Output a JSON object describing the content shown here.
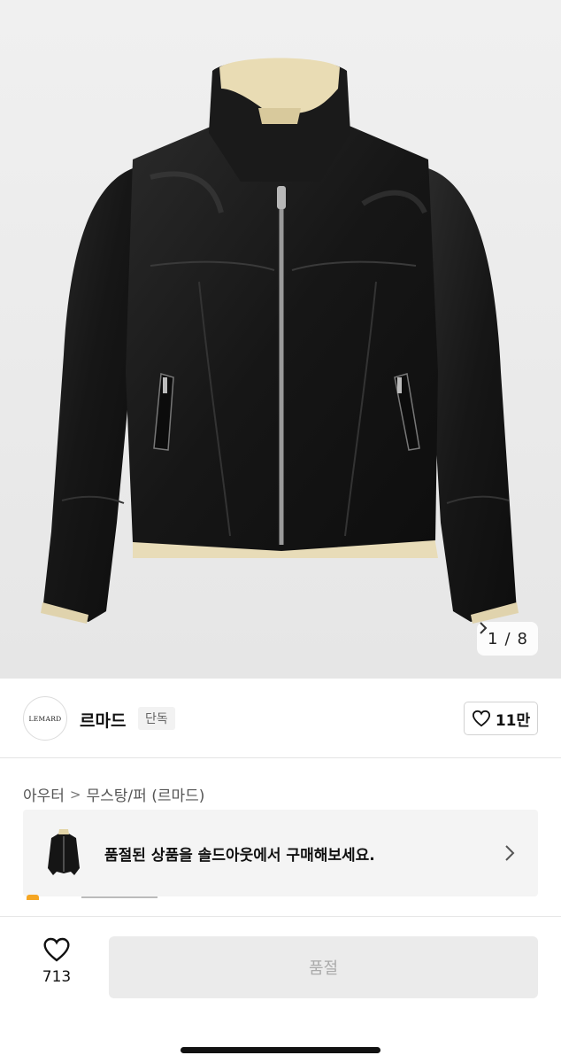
{
  "gallery": {
    "current": "1",
    "separator": "/",
    "total": "8",
    "next_icon": "chevron-right-icon"
  },
  "brand": {
    "logo_text": "LEMARD",
    "name": "르마드",
    "badge": "단독",
    "like_count": "11만",
    "like_icon": "heart-outline-icon"
  },
  "breadcrumb": {
    "items": [
      "아우터",
      "무스탕/퍼 (르마드)"
    ],
    "separator": ">"
  },
  "soldout_banner": {
    "text": "품절된 상품을 솔드아웃에서 구매해보세요.",
    "chevron_icon": "chevron-right-icon"
  },
  "bottom_bar": {
    "wish_count": "713",
    "wish_icon": "heart-outline-icon",
    "action_label": "품절"
  },
  "colors": {
    "background": "#ffffff",
    "hero_bg": "#ececec",
    "disabled_button": "#ebebeb",
    "disabled_text": "#aaaaaa",
    "accent_star": "#f5a623"
  }
}
